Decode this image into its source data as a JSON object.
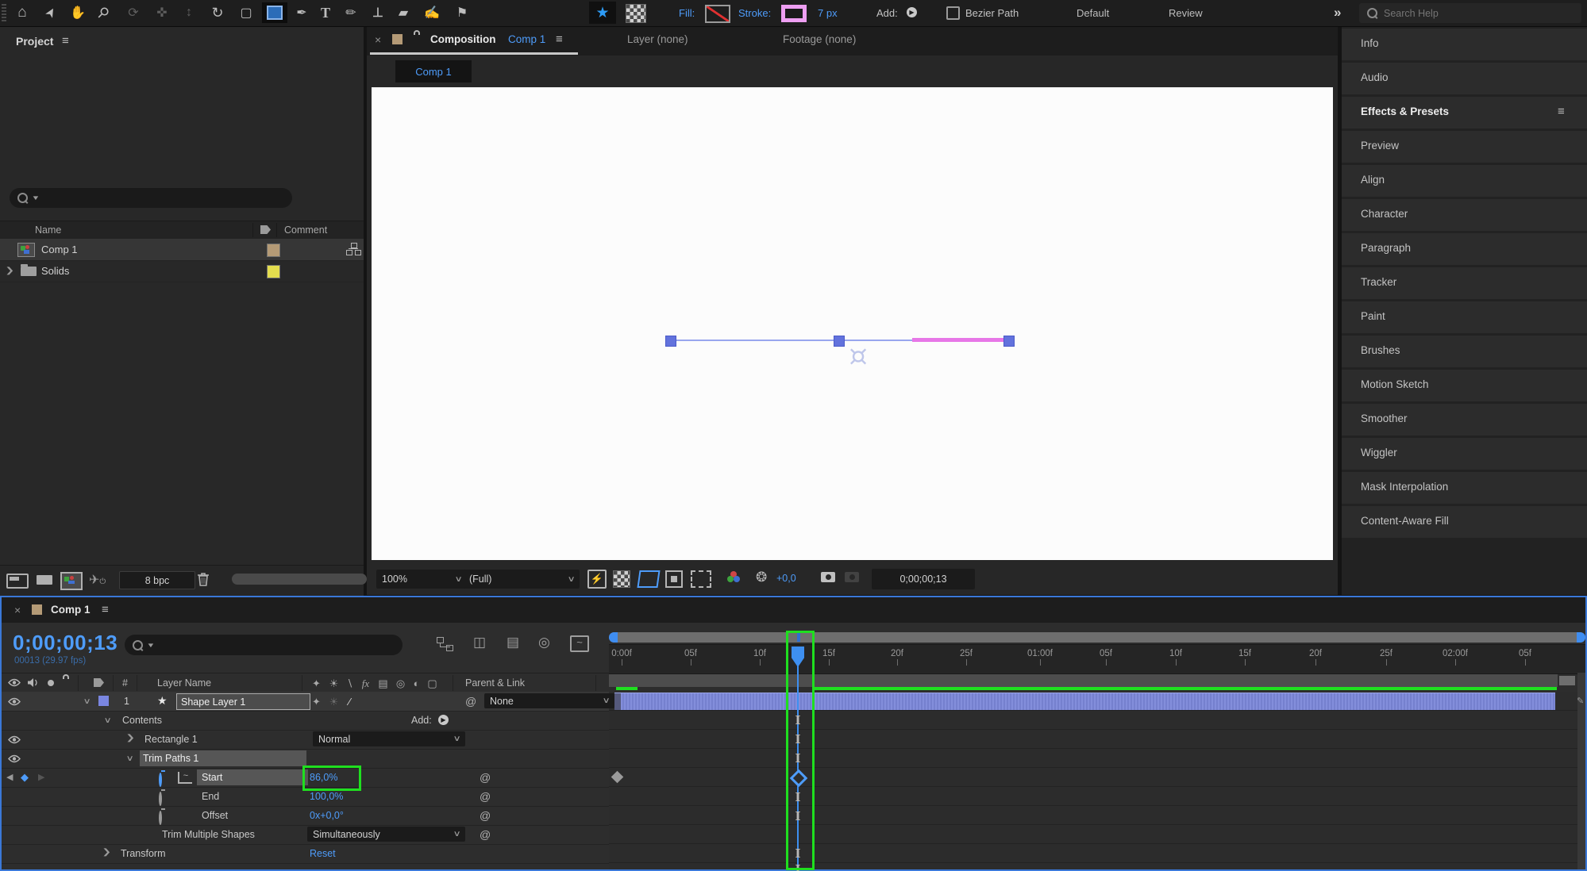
{
  "app": {
    "title": "Adobe After Effects"
  },
  "toolbar": {
    "tools": [
      {
        "name": "home",
        "glyph": "⌂"
      },
      {
        "name": "selection",
        "glyph": "➤"
      },
      {
        "name": "hand",
        "glyph": "✋"
      },
      {
        "name": "zoom",
        "glyph": "⚲"
      },
      {
        "name": "orbit-camera",
        "glyph": "⟳"
      },
      {
        "name": "pan-camera",
        "glyph": "✜"
      },
      {
        "name": "dolly-camera",
        "glyph": "↕"
      },
      {
        "name": "rotation",
        "glyph": "↻"
      },
      {
        "name": "pan-behind",
        "glyph": "▢"
      },
      {
        "name": "rectangle",
        "glyph": ""
      },
      {
        "name": "pen",
        "glyph": "✒"
      },
      {
        "name": "type",
        "glyph": "T"
      },
      {
        "name": "brush",
        "glyph": "✏"
      },
      {
        "name": "clone-stamp",
        "glyph": "⊥"
      },
      {
        "name": "eraser",
        "glyph": "▰"
      },
      {
        "name": "roto-brush",
        "glyph": "✍"
      },
      {
        "name": "puppet-pin",
        "glyph": "⚑"
      }
    ],
    "fill_label": "Fill:",
    "stroke_label": "Stroke:",
    "stroke_width": "7 px",
    "add_label": "Add:",
    "bezier_path_label": "Bezier Path",
    "workspaces": [
      "Default",
      "Review"
    ],
    "overflow_glyph": "»",
    "search_placeholder": "Search Help"
  },
  "project_panel": {
    "title": "Project",
    "menu_glyph": "≡",
    "columns": {
      "name": "Name",
      "comment": "Comment"
    },
    "items": [
      {
        "name": "Comp 1",
        "type": "composition",
        "label_color": "#b49a76"
      },
      {
        "name": "Solids",
        "type": "folder",
        "label_color": "#e3dd4e"
      }
    ],
    "bit_depth": "8 bpc"
  },
  "composition_panel": {
    "close_glyph": "×",
    "tab_label": "Composition",
    "tab_target": "Comp 1",
    "tab_layer": "Layer (none)",
    "tab_footage": "Footage (none)",
    "subtab": "Comp 1",
    "zoom": "100%",
    "resolution": "(Full)",
    "exposure": "+0,0",
    "timecode": "0;00;00;13"
  },
  "right_panels": {
    "items": [
      "Info",
      "Audio",
      "Effects & Presets",
      "Preview",
      "Align",
      "Character",
      "Paragraph",
      "Tracker",
      "Paint",
      "Brushes",
      "Motion Sketch",
      "Smoother",
      "Wiggler",
      "Mask Interpolation",
      "Content-Aware Fill"
    ],
    "active": "Effects & Presets",
    "menu_glyph": "≡"
  },
  "timeline": {
    "tab": "Comp 1",
    "close_glyph": "×",
    "menu_glyph": "≡",
    "timecode": "0;00;00;13",
    "frame_info": "00013 (29.97 fps)",
    "ruler": [
      "0:00f",
      "05f",
      "10f",
      "15f",
      "20f",
      "25f",
      "01:00f",
      "05f",
      "10f",
      "15f",
      "20f",
      "25f",
      "02:00f",
      "05f"
    ],
    "columns": {
      "number": "#",
      "layer_name": "Layer Name",
      "parent": "Parent & Link",
      "fx": "fx"
    },
    "layer": {
      "index": "1",
      "name": "Shape Layer 1",
      "parent": "None"
    },
    "contents_label": "Contents",
    "add_label": "Add:",
    "rectangle": {
      "name": "Rectangle 1",
      "blend_mode": "Normal"
    },
    "trim_paths": {
      "name": "Trim Paths 1",
      "start_label": "Start",
      "start_value": "86,0%",
      "end_label": "End",
      "end_value": "100,0%",
      "offset_label": "Offset",
      "offset_value": "0x+0,0°",
      "tms_label": "Trim Multiple Shapes",
      "tms_value": "Simultaneously"
    },
    "transform_label": "Transform",
    "transform_value": "Reset"
  },
  "colors": {
    "accent_blue": "#4e9cfa",
    "annotation_green": "#1fdf1f",
    "layer_bar_purple": "#7b87d9",
    "stroke_pink": "#ee9ff2",
    "shape_line_blue": "#98a6ee",
    "label_tan": "#b49a76",
    "label_yellow": "#e3dd4e",
    "selected_tool_blue": "#2b6cb8"
  }
}
